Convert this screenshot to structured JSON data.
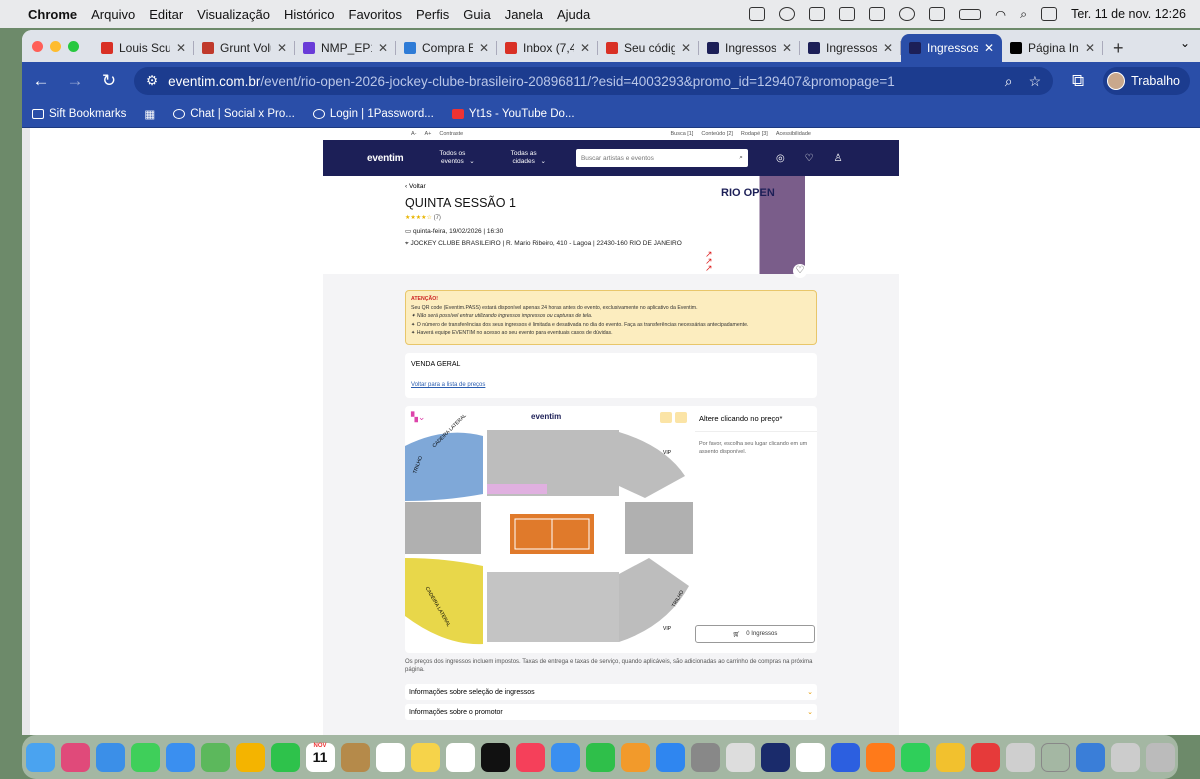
{
  "menubar": {
    "apple": "",
    "app": "Chrome",
    "items": [
      "Arquivo",
      "Editar",
      "Visualização",
      "Histórico",
      "Favoritos",
      "Perfis",
      "Guia",
      "Janela",
      "Ajuda"
    ],
    "clock": "Ter. 11 de nov.  12:26"
  },
  "tabs": [
    {
      "title": "Louis Scu",
      "color": "#d93025",
      "icon": "gmail-icon"
    },
    {
      "title": "Grunt Volu",
      "color": "#c0392b",
      "icon": "asana-icon"
    },
    {
      "title": "NMP_EP12",
      "color": "#6a3cd8",
      "icon": "wave-icon"
    },
    {
      "title": "Compra E",
      "color": "#2e7bd6",
      "icon": "gear-icon"
    },
    {
      "title": "Inbox (7,4",
      "color": "#d93025",
      "icon": "gmail-icon"
    },
    {
      "title": "Seu códig",
      "color": "#d93025",
      "icon": "gmail-icon"
    },
    {
      "title": "Ingressos",
      "color": "#1c1f57",
      "icon": "eventim-icon"
    },
    {
      "title": "Ingressos",
      "color": "#1c1f57",
      "icon": "eventim-icon"
    },
    {
      "title": "Ingressos",
      "color": "#1c1f57",
      "icon": "eventim-icon",
      "active": true
    },
    {
      "title": "Página Ini",
      "color": "#000",
      "icon": "x-icon"
    }
  ],
  "address": {
    "host": "eventim.com.br",
    "path": "/event/rio-open-2026-jockey-clube-brasileiro-20896811/?esid=4003293&promo_id=129407&promopage=1",
    "profile": "Trabalho"
  },
  "bookmarks": [
    "Sift Bookmarks",
    "Chat | Social x Pro...",
    "Login | 1Password...",
    "Yt1s - YouTube Do..."
  ],
  "a11y": {
    "left": [
      "A-",
      "A+",
      "Contraste"
    ],
    "right": [
      "Busca [1]",
      "Conteúdo [2]",
      "Rodapé [3]",
      "Acessibilidade"
    ]
  },
  "site": {
    "logo": "eventim",
    "nav1": "Todos os eventos",
    "nav2": "Todas as cidades",
    "search_placeholder": "Buscar artistas e eventos"
  },
  "event": {
    "back": "Voltar",
    "title": "QUINTA SESSÃO 1",
    "rating": "★★★★☆",
    "rating_count": "(7)",
    "date": "quinta-feira, 19/02/2026 | 16:30",
    "location": "JOCKEY CLUBE BRASILEIRO | R. Mario Ribeiro, 410 - Lagoa | 22430-160 RIO DE JANEIRO",
    "poster_text": "RIO OPEN"
  },
  "notice": {
    "heading": "ATENÇÃO!",
    "lines": [
      "Seu QR code (Eventim.PASS) estará disponível apenas 24 horas antes do evento, exclusivamente no aplicativo da Eventim.",
      "✦ Não será possível entrar utilizando ingressos impressos ou capturas de tela.",
      "✦ O número de transferências dos seus ingressos é limitada e desativada no dia do evento. Faça as transferências necessárias antecipadamente.",
      "✦ Haverá equipe EVENTIM no acesso ao seu evento para eventuais casos de dúvidas."
    ]
  },
  "venda": {
    "title": "VENDA GERAL",
    "link": "Voltar para a lista de preços"
  },
  "map": {
    "logo": "eventim",
    "labels": [
      "CADEIRA LATERAL",
      "TRILHO",
      "VIP",
      "CADEIRA LATERAL",
      "TRILHO",
      "VIP"
    ]
  },
  "price_panel": {
    "title": "Altere clicando no preço*",
    "desc": "Por favor, escolha seu lugar clicando em um assento disponível.",
    "cart": "0 Ingressos"
  },
  "taxes": "Os preços dos ingressos incluem impostos. Taxas de entrega e taxas de serviço, quando aplicáveis, são adicionadas ao carrinho de compras na próxima página.",
  "accordions": [
    "Informações sobre seleção de ingressos",
    "Informações sobre o promotor"
  ],
  "dock_calendar": {
    "month": "NOV",
    "day": "11"
  }
}
